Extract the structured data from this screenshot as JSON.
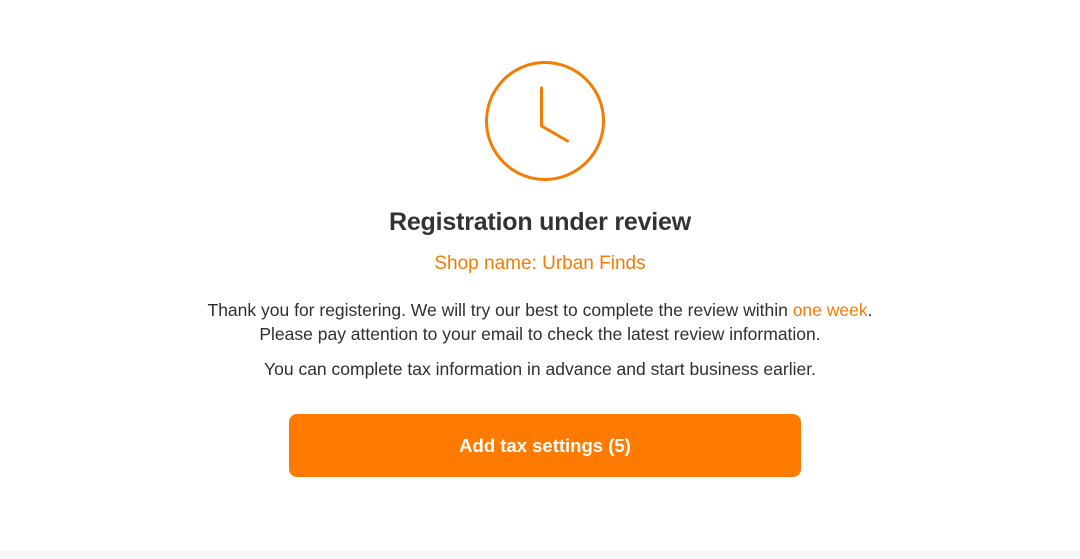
{
  "status": {
    "title": "Registration under review",
    "shop_name": "Shop name: Urban Finds",
    "icon": "clock-icon",
    "accent_color": "#ff7a00"
  },
  "message": {
    "line1_prefix": "Thank you for registering. We will try our best to complete the review within ",
    "line1_highlight": "one week",
    "line1_suffix": ".",
    "line2": "Please pay attention to your email to check the latest review information.",
    "tax_note": "You can complete tax information in advance and start business earlier."
  },
  "action": {
    "button_label": "Add tax settings (5)"
  }
}
